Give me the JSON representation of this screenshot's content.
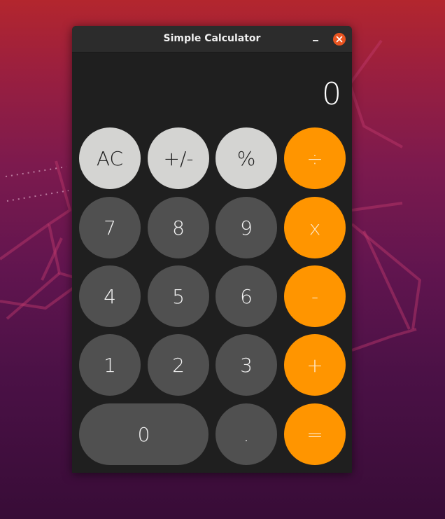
{
  "window": {
    "title": "Simple Calculator"
  },
  "display": {
    "value": "0"
  },
  "keys": {
    "ac": "AC",
    "sign": "+/-",
    "percent": "%",
    "divide": "÷",
    "seven": "7",
    "eight": "8",
    "nine": "9",
    "multiply": "x",
    "four": "4",
    "five": "5",
    "six": "6",
    "subtract": "-",
    "one": "1",
    "two": "2",
    "three": "3",
    "add": "+",
    "zero": "0",
    "decimal": ".",
    "equals": "="
  },
  "colors": {
    "function_key": "#d4d4d2",
    "digit_key": "#505050",
    "operator_key": "#ff9500",
    "window_bg": "#1f1f1f",
    "titlebar": "#2c2c2c",
    "close_button": "#e95420"
  }
}
